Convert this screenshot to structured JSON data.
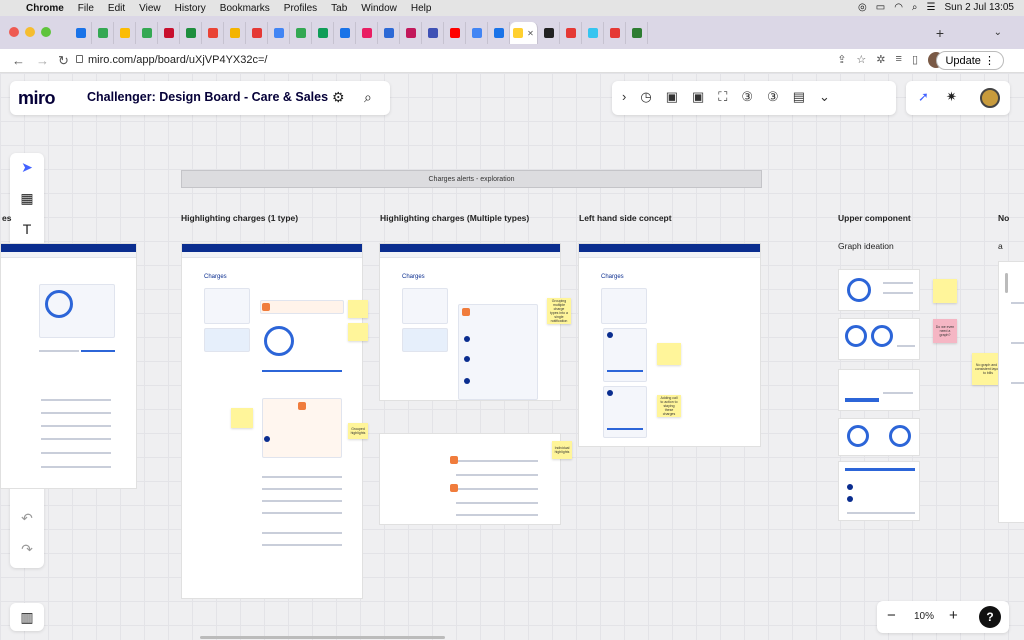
{
  "menubar": {
    "app": "Chrome",
    "menus": [
      "File",
      "Edit",
      "View",
      "History",
      "Bookmarks",
      "Profiles",
      "Tab",
      "Window",
      "Help"
    ],
    "datetime": "Sun 2 Jul  13:05"
  },
  "browser": {
    "url": "miro.com/app/board/uXjVP4YX32c=/",
    "update_label": "Update",
    "new_tab": "+"
  },
  "board": {
    "logo": "miro",
    "name": "Challenger: Design Board - Care & Sales"
  },
  "zoom": {
    "minus": "−",
    "value": "10%",
    "plus": "+",
    "help": "?"
  },
  "canvas": {
    "banner": "Charges alerts - exploration",
    "sections": [
      {
        "title": "es"
      },
      {
        "title": "Highlighting charges (1 type)"
      },
      {
        "title": "Highlighting charges (Multiple types)"
      },
      {
        "title": "Left hand side concept"
      },
      {
        "title": "Upper component"
      },
      {
        "title": "No"
      }
    ],
    "upper_subtitle": "Graph ideation",
    "edge_a": "a",
    "frame_heading": "Charges",
    "stickies": {
      "s1": "Grouped highlights",
      "s2": "Individual highlights",
      "s3": "Do we even need a graph?",
      "s4": "No graph and a consistent layout to bills",
      "s5": "Grouping multiple charge types into a single notification",
      "s6": "Adding call to action to staying these charges"
    }
  }
}
